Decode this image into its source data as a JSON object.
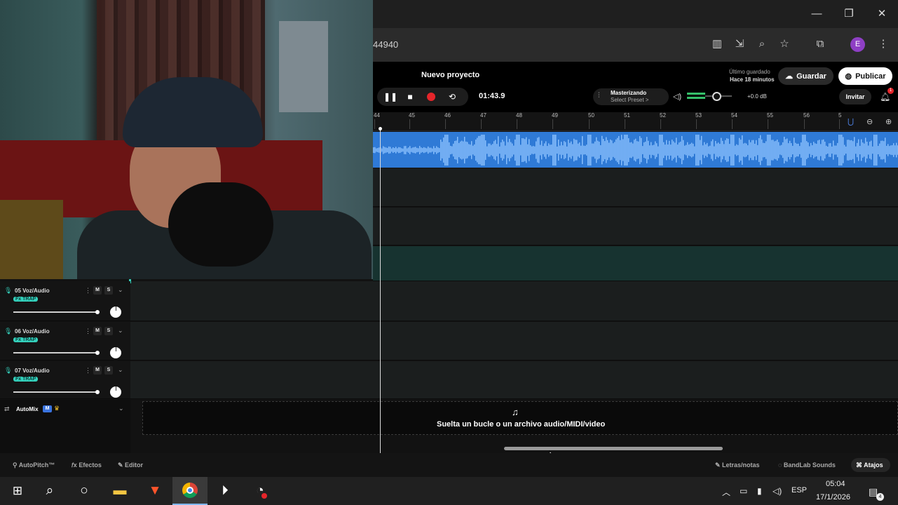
{
  "browser": {
    "url_fragment": "44940",
    "avatar_letter": "E"
  },
  "app": {
    "project_title": "Nuevo proyecto",
    "last_saved_label": "Último guardado",
    "last_saved_time": "Hace 18 minutos",
    "save_label": "Guardar",
    "publish_label": "Publicar",
    "time": "01:43.9",
    "mastering_label": "Masterizando",
    "preset_label": "Select Preset >",
    "db_value": "+0.0 dB",
    "invite_label": "Invitar",
    "notif_count": "1"
  },
  "ruler": {
    "ticks": [
      "44",
      "45",
      "46",
      "47",
      "48",
      "49",
      "50",
      "51",
      "52",
      "53",
      "54",
      "55",
      "56",
      "5"
    ]
  },
  "tracks": [
    {
      "name": "05  Voz/Audio",
      "fx": "Fx TRAP",
      "mute": "M",
      "solo": "S"
    },
    {
      "name": "06  Voz/Audio",
      "fx": "Fx TRAP",
      "mute": "M",
      "solo": "S"
    },
    {
      "name": "07  Voz/Audio",
      "fx": "Fx TRAP",
      "mute": "M",
      "solo": "S"
    }
  ],
  "automix": {
    "label": "AutoMix",
    "badge": "M"
  },
  "dropzone": {
    "text": "Suelta un bucle o un archivo audio/MIDI/video"
  },
  "bottombar": {
    "autopitch": "AutoPitch™",
    "effects": "Efectos",
    "editor": "Editor",
    "lyrics": "Letras/notas",
    "sounds": "BandLab Sounds",
    "shortcuts": "Atajos"
  },
  "taskbar": {
    "lang": "ESP",
    "time": "05:04",
    "date": "17/1/2026",
    "notif": "4"
  },
  "colors": {
    "clip_blue": "#2f7ad6",
    "record_red": "#e5252a",
    "fx_teal": "#34d1bc",
    "meter_green": "#35c06a"
  }
}
